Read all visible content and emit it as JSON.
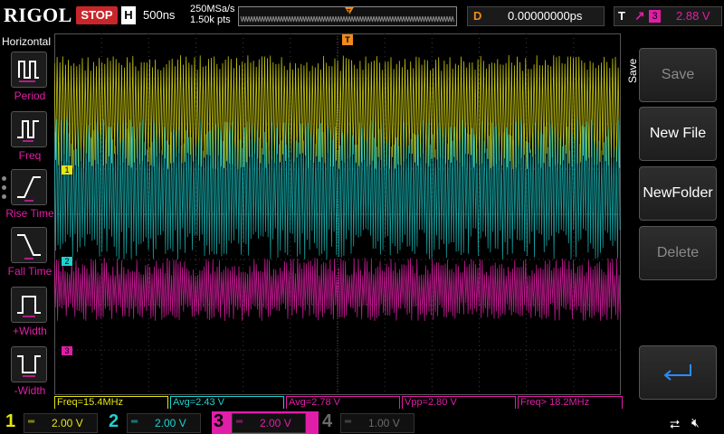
{
  "brand": "RIGOL",
  "run_state": "STOP",
  "horizontal": {
    "mode_letter": "H",
    "timebase": "500ns",
    "sample_rate": "250MSa/s",
    "mem_depth": "1.50k pts"
  },
  "delay": {
    "letter": "D",
    "value": "0.00000000ps"
  },
  "trigger": {
    "letter": "T",
    "edge_icon": "rising-edge-icon",
    "source": "3",
    "level": "2.88 V"
  },
  "left_menu": {
    "title": "Horizontal",
    "items": [
      {
        "label": "Period",
        "icon": "period-icon"
      },
      {
        "label": "Freq",
        "icon": "frequency-icon"
      },
      {
        "label": "Rise Time",
        "icon": "rise-time-icon"
      },
      {
        "label": "Fall Time",
        "icon": "fall-time-icon"
      },
      {
        "label": "+Width",
        "icon": "positive-width-icon"
      },
      {
        "label": "-Width",
        "icon": "negative-width-icon"
      }
    ]
  },
  "right_menu": {
    "title": "Save",
    "buttons": [
      {
        "label": "Save",
        "enabled": false
      },
      {
        "label": "New File",
        "enabled": true
      },
      {
        "label": "NewFolder",
        "enabled": true
      },
      {
        "label": "Delete",
        "enabled": false
      }
    ],
    "return_icon": "enter-return-icon"
  },
  "markers": {
    "ch1": "1",
    "ch2": "2",
    "ch3": "3",
    "trig_pos": "T",
    "trig_level": "T"
  },
  "measurements": [
    {
      "text": "Freq=15.4MHz",
      "color": "#e6e614"
    },
    {
      "text": "Avg=2.43 V",
      "color": "#1ed2d2"
    },
    {
      "text": "Avg=2.78 V",
      "color": "#e01ea8"
    },
    {
      "text": "Vpp=2.80 V",
      "color": "#e01ea8"
    },
    {
      "text": "Freq> 18.2MHz",
      "color": "#e01ea8"
    }
  ],
  "channels": [
    {
      "num": "1",
      "scale": "2.00 V",
      "color": "#e6e614",
      "active": true
    },
    {
      "num": "2",
      "scale": "2.00 V",
      "color": "#1ed2d2",
      "active": true
    },
    {
      "num": "3",
      "scale": "2.00 V",
      "color": "#e01ea8",
      "active": true
    },
    {
      "num": "4",
      "scale": "1.00 V",
      "color": "#5a5a5a",
      "active": false
    }
  ],
  "colors": {
    "ch1": "#e6e614",
    "ch2": "#1ed2d2",
    "ch3": "#e01ea8",
    "accent": "#f08a1c",
    "stop": "#c8262b"
  }
}
